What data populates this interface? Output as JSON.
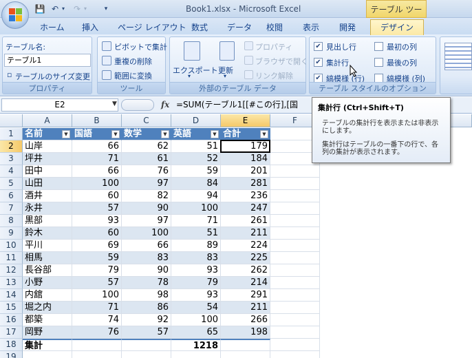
{
  "window": {
    "doc_title": "Book1.xlsx - Microsoft Excel",
    "context_tab_group": "テーブル ツール"
  },
  "tabs": [
    "ホーム",
    "挿入",
    "ページ レイアウト",
    "数式",
    "データ",
    "校閲",
    "表示",
    "開発",
    "デザイン"
  ],
  "ribbon": {
    "properties": {
      "table_name_label": "テーブル名:",
      "table_name_value": "テーブル1",
      "resize_label": "テーブルのサイズ変更",
      "group_label": "プロパティ"
    },
    "tools": {
      "pivot": "ピボットで集計",
      "remove_dup": "重複の削除",
      "convert_range": "範囲に変換",
      "group_label": "ツール"
    },
    "external": {
      "export": "エクスポート",
      "refresh": "更新",
      "properties": "プロパティ",
      "open_browser": "ブラウザで開く",
      "unlink": "リンク解除",
      "group_label": "外部のテーブル データ"
    },
    "style_options": {
      "header_row": "見出し行",
      "total_row": "集計行",
      "banded_rows": "縞模様 (行)",
      "first_col": "最初の列",
      "last_col": "最後の列",
      "banded_cols": "縞模様 (列)",
      "group_label": "テーブル スタイルのオプション",
      "checked": {
        "header_row": true,
        "total_row": true,
        "banded_rows": true,
        "first_col": false,
        "last_col": false,
        "banded_cols": false
      }
    }
  },
  "formula_bar": {
    "name_box": "E2",
    "fx": "fx",
    "formula": "=SUM(テーブル1[[#この行],[国"
  },
  "tooltip": {
    "title": "集計行 (Ctrl+Shift+T)",
    "line1": "テーブルの集計行を表示または非表示にします。",
    "line2": "集計行はテーブルの一番下の行で、各列の集計が表示されます。"
  },
  "grid": {
    "columns": [
      "A",
      "B",
      "C",
      "D",
      "E",
      "F"
    ],
    "headers": [
      "名前",
      "国語",
      "数学",
      "英語",
      "合計"
    ],
    "rows": [
      [
        "山岸",
        66,
        62,
        51,
        179
      ],
      [
        "坪井",
        71,
        61,
        52,
        184
      ],
      [
        "田中",
        66,
        76,
        59,
        201
      ],
      [
        "山田",
        100,
        97,
        84,
        281
      ],
      [
        "酒井",
        60,
        82,
        94,
        236
      ],
      [
        "永井",
        57,
        90,
        100,
        247
      ],
      [
        "黒部",
        93,
        97,
        71,
        261
      ],
      [
        "鈴木",
        60,
        100,
        51,
        211
      ],
      [
        "平川",
        69,
        66,
        89,
        224
      ],
      [
        "相馬",
        59,
        83,
        83,
        225
      ],
      [
        "長谷部",
        79,
        90,
        93,
        262
      ],
      [
        "小野",
        57,
        78,
        79,
        214
      ],
      [
        "内舘",
        100,
        98,
        93,
        291
      ],
      [
        "堀之内",
        71,
        86,
        54,
        211
      ],
      [
        "都築",
        74,
        92,
        100,
        266
      ],
      [
        "岡野",
        76,
        57,
        65,
        198
      ]
    ],
    "total_label": "集計",
    "total_value": 1218,
    "row_numbers": [
      "1",
      "2",
      "3",
      "4",
      "5",
      "6",
      "7",
      "8",
      "9",
      "10",
      "11",
      "12",
      "13",
      "14",
      "15",
      "16",
      "17",
      "18",
      "19"
    ]
  },
  "colors": {
    "table_header": "#4f81bd",
    "band": "#dce6f1",
    "ribbon_bg": "#d2e1f3"
  }
}
